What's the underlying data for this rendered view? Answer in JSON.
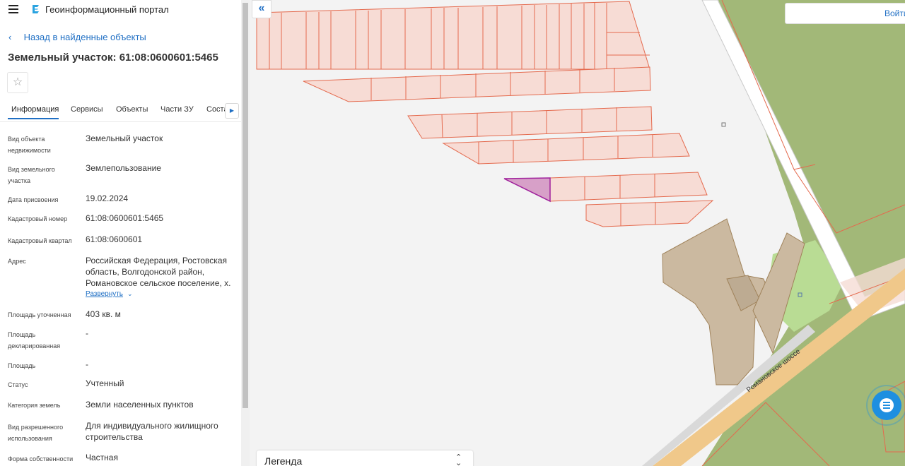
{
  "header": {
    "menu_icon": "menu-icon",
    "logo_icon": "portal-logo-icon",
    "title": "Геоинформационный портал"
  },
  "nav": {
    "back_label": "Назад в найденные объекты",
    "back_icon": "chevron-left-icon"
  },
  "object": {
    "title": "Земельный участок: 61:08:0600601:5465",
    "favorite_icon": "star-icon"
  },
  "tabs": [
    {
      "label": "Информация",
      "active": true
    },
    {
      "label": "Сервисы"
    },
    {
      "label": "Объекты"
    },
    {
      "label": "Части ЗУ"
    },
    {
      "label": "Соста"
    }
  ],
  "tabs_more_icon": "chevron-right-icon",
  "properties": [
    {
      "label": "Вид объекта недвижимости",
      "value": "Земельный участок"
    },
    {
      "label": "Вид земельного участка",
      "value": "Землепользование"
    },
    {
      "label": "Дата присвоения",
      "value": "19.02.2024"
    },
    {
      "label": "Кадастровый номер",
      "value": "61:08:0600601:5465"
    },
    {
      "label": "Кадастровый квартал",
      "value": "61:08:0600601"
    },
    {
      "label": "Адрес",
      "value": "Российская Федерация, Ростовская область, Волгодонской район, Романовское сельское поселение, х."
    },
    {
      "label": "Площадь уточненная",
      "value": "403 кв. м"
    },
    {
      "label": "Площадь декларированная",
      "value": "-"
    },
    {
      "label": "Площадь",
      "value": "-"
    },
    {
      "label": "Статус",
      "value": "Учтенный"
    },
    {
      "label": "Категория земель",
      "value": "Земли населенных пунктов"
    },
    {
      "label": "Вид разрешенного использования",
      "value": "Для индивидуального жилищного строительства"
    },
    {
      "label": "Форма собственности",
      "value": "Частная"
    }
  ],
  "address_expand": "Развернуть",
  "map": {
    "collapse_icon": "double-chevron-left-icon",
    "login_button": "Войти",
    "road_label": "Романовское шоссе",
    "legend_label": "Легенда",
    "legend_icon": "expand-collapse-icon",
    "chat_icon": "chat-icon",
    "colors": {
      "parcel_fill": "#f7dcd5",
      "parcel_stroke": "#e46a4e",
      "selected_fill": "#d7a0c8",
      "selected_stroke": "#a0229c",
      "green": "#a2b878",
      "light_green": "#b9dc94",
      "brown": "#cbb9a0",
      "road": "#f0c88a"
    }
  }
}
